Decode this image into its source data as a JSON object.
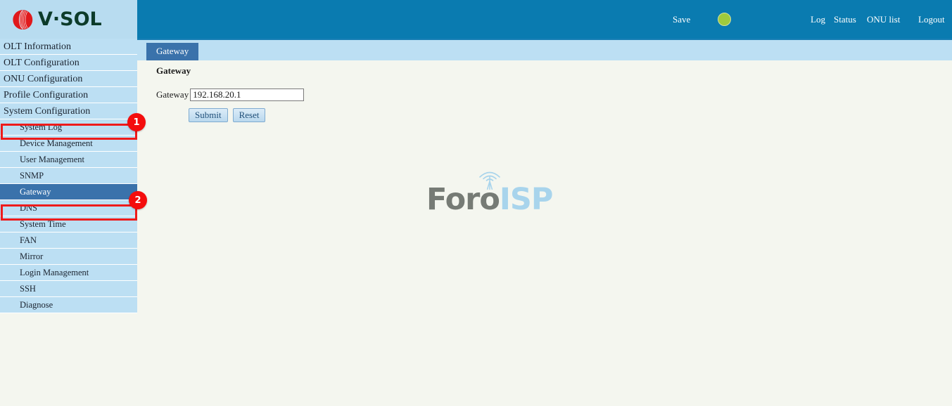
{
  "brand": {
    "logo_text": "V·SOL",
    "logo_icon": "vsol-emblem-icon",
    "logo_color": "#0c3b2a",
    "emblem_color": "#e0191c"
  },
  "header": {
    "background_color": "#0a7bb0",
    "save_label": "Save",
    "status_indicator": {
      "icon": "status-dot-icon",
      "color": "#9fca3d"
    },
    "links": [
      {
        "label": "Log"
      },
      {
        "label": "Status"
      },
      {
        "label": "ONU list"
      },
      {
        "label": "Logout"
      }
    ]
  },
  "tabs": [
    {
      "label": "Gateway",
      "active": true
    }
  ],
  "sidebar": {
    "background_color": "#bcdff3",
    "selected_color": "#3a72ab",
    "items": [
      {
        "label": "OLT Information",
        "level": 0,
        "selected": false
      },
      {
        "label": "OLT Configuration",
        "level": 0,
        "selected": false
      },
      {
        "label": "ONU Configuration",
        "level": 0,
        "selected": false
      },
      {
        "label": "Profile Configuration",
        "level": 0,
        "selected": false
      },
      {
        "label": "System Configuration",
        "level": 0,
        "selected": false
      },
      {
        "label": "System Log",
        "level": 1,
        "selected": false
      },
      {
        "label": "Device Management",
        "level": 1,
        "selected": false
      },
      {
        "label": "User Management",
        "level": 1,
        "selected": false
      },
      {
        "label": "SNMP",
        "level": 1,
        "selected": false
      },
      {
        "label": "Gateway",
        "level": 1,
        "selected": true
      },
      {
        "label": "DNS",
        "level": 1,
        "selected": false
      },
      {
        "label": "System Time",
        "level": 1,
        "selected": false
      },
      {
        "label": "FAN",
        "level": 1,
        "selected": false
      },
      {
        "label": "Mirror",
        "level": 1,
        "selected": false
      },
      {
        "label": "Login Management",
        "level": 1,
        "selected": false
      },
      {
        "label": "SSH",
        "level": 1,
        "selected": false
      },
      {
        "label": "Diagnose",
        "level": 1,
        "selected": false
      }
    ]
  },
  "annotations": {
    "color": "#ee1b1b",
    "badges": [
      {
        "number": "1",
        "target": "System Configuration"
      },
      {
        "number": "2",
        "target": "Gateway"
      }
    ]
  },
  "main": {
    "section_title": "Gateway",
    "form": {
      "gateway_label": "Gateway",
      "gateway_value": "192.168.20.1",
      "gateway_placeholder": "",
      "submit_label": "Submit",
      "reset_label": "Reset"
    }
  },
  "watermark": {
    "text_primary": "Foro",
    "text_secondary": "ISP",
    "icon": "antenna-tower-icon",
    "primary_color": "#767b75",
    "secondary_color": "#a8d4ec"
  }
}
